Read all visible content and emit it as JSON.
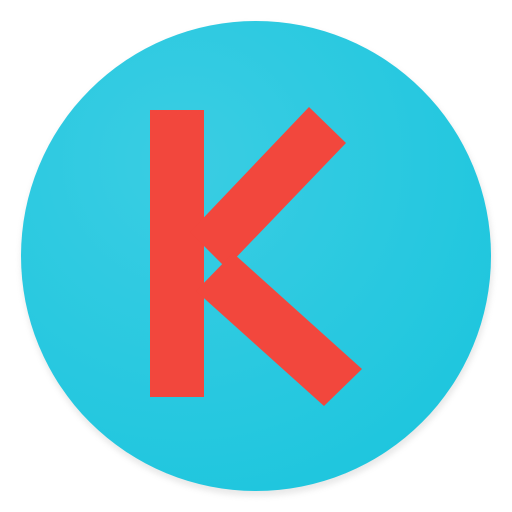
{
  "logo": {
    "letter": "K",
    "icon_name": "k-letter-icon",
    "colors": {
      "circle": "#1FC6DE",
      "circle_highlight": "#3ACDE3",
      "letter": "#F2473D",
      "shadow": "#cfcfcf"
    }
  }
}
